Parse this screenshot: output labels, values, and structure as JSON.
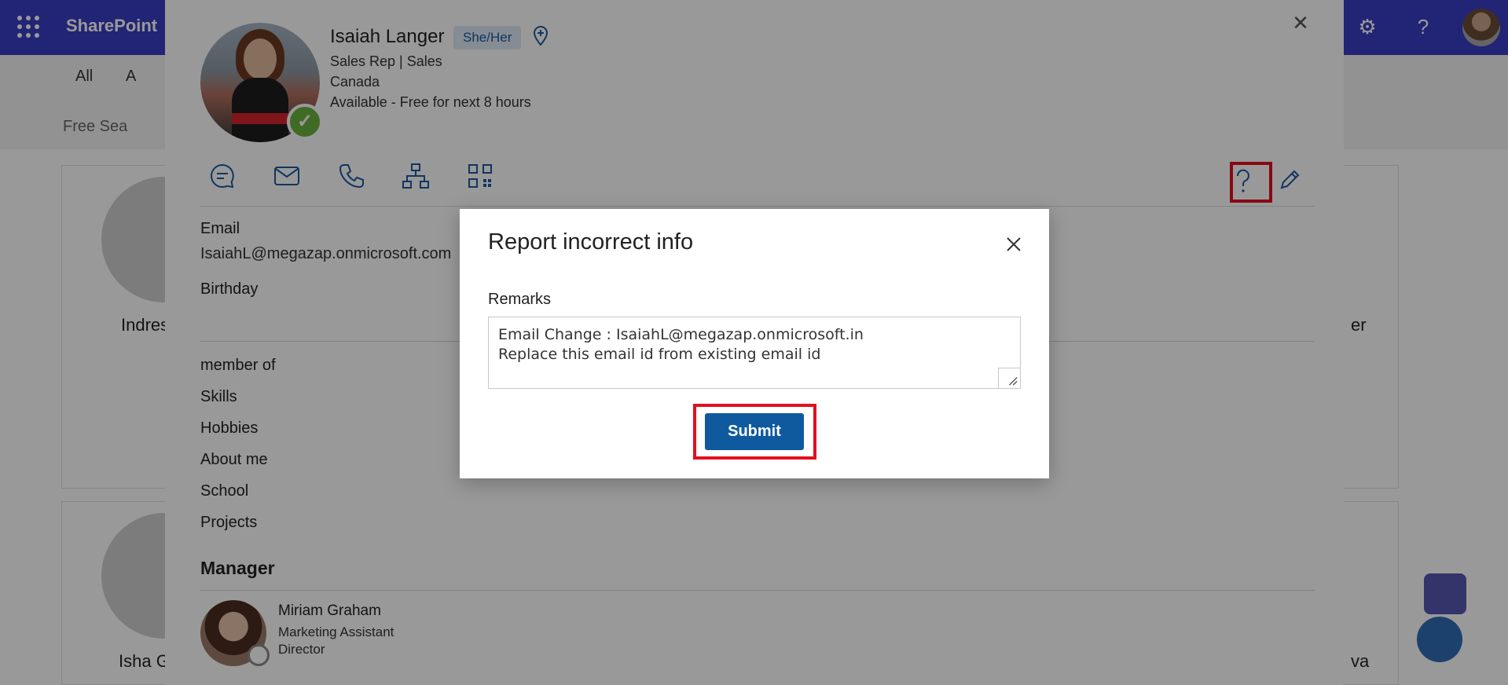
{
  "suitebar": {
    "brand": "SharePoint",
    "settings_icon": "gear-icon",
    "help_icon": "question-icon"
  },
  "filter": {
    "letters": [
      "All",
      "A"
    ],
    "search_placeholder": "Free Sea"
  },
  "background_people": [
    {
      "name": "Indres"
    },
    {
      "name": "Isha G"
    },
    {
      "name": "er"
    },
    {
      "name": "va"
    }
  ],
  "profile": {
    "name": "Isaiah Langer",
    "pronouns": "She/Her",
    "title_line": "Sales Rep | Sales",
    "location": "Canada",
    "availability": "Available - Free for next 8 hours",
    "actions": [
      "chat-icon",
      "mail-icon",
      "phone-icon",
      "org-chart-icon",
      "qr-code-icon"
    ],
    "email_label": "Email",
    "email_value": "IsaiahL@megazap.onmicrosoft.com",
    "birthday_label": "Birthday",
    "fields": [
      "member of",
      "Skills",
      "Hobbies",
      "About me",
      "School",
      "Projects"
    ],
    "manager_heading": "Manager",
    "manager": {
      "name": "Miriam Graham",
      "title": "Marketing Assistant",
      "role": "Director"
    }
  },
  "dialog": {
    "title": "Report incorrect info",
    "remarks_label": "Remarks",
    "remarks_value": "Email Change : IsaiahL@megazap.onmicrosoft.in\nReplace this email id from existing email id",
    "submit_label": "Submit"
  },
  "colors": {
    "suitebar": "#3a3dc4",
    "primary_button": "#0f5a9e",
    "highlight": "#e3101e",
    "presence_available": "#6bb33e"
  }
}
